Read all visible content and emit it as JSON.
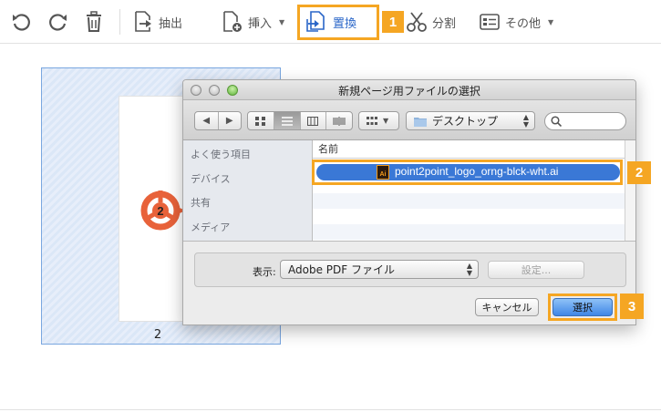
{
  "toolbar": {
    "undo_icon": "undo-icon",
    "redo_icon": "redo-icon",
    "delete_icon": "trash-icon",
    "extract_label": "抽出",
    "insert_label": "挿入",
    "replace_label": "置換",
    "split_label": "分割",
    "more_label": "その他",
    "accent_color": "#2a66c8"
  },
  "annotations": {
    "step1": "1",
    "step2": "2",
    "step3": "3",
    "color": "#f5a623"
  },
  "thumbnail": {
    "page_number": "2",
    "logo_text": "2"
  },
  "dialog": {
    "title": "新規ページ用ファイルの選択",
    "location": "デスクトップ",
    "sidebar": [
      "よく使う項目",
      "デバイス",
      "共有",
      "メディア"
    ],
    "column_name": "名前",
    "selected_file": "point2point_logo_orng-blck-wht.ai",
    "file_icon_text": "Ai",
    "show_label": "表示:",
    "format_value": "Adobe PDF ファイル",
    "settings_label": "設定...",
    "cancel_label": "キャンセル",
    "select_label": "選択"
  }
}
